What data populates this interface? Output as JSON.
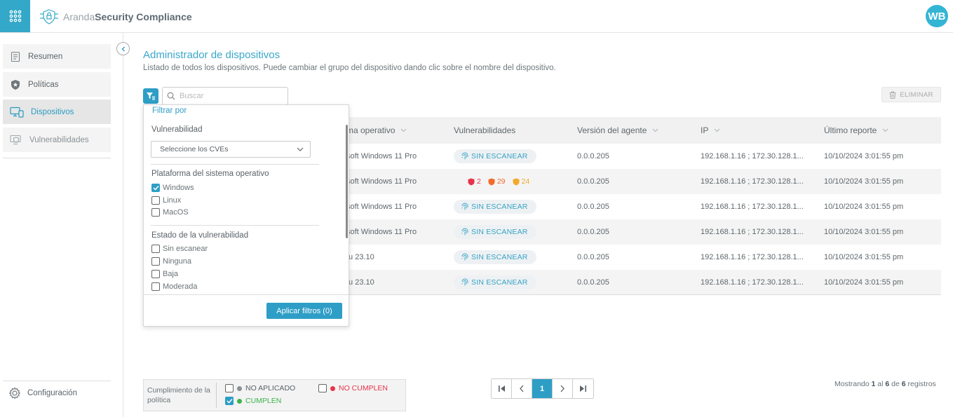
{
  "header": {
    "brand_light": "Aranda",
    "brand_bold": "Security Compliance",
    "avatar_initials": "WB"
  },
  "sidebar": {
    "items": [
      {
        "label": "Resumen",
        "icon": "report-icon"
      },
      {
        "label": "Políticas",
        "icon": "shield-star-icon"
      },
      {
        "label": "Dispositivos",
        "icon": "devices-icon"
      },
      {
        "label": "Vulnerabilidades",
        "icon": "vulnerability-icon"
      }
    ],
    "config_label": "Configuración"
  },
  "main": {
    "title": "Administrador de dispositivos",
    "subtitle": "Listado de todos los dispositivos. Puede cambiar el grupo del dispositivo dando clic sobre el nombre del dispositivo.",
    "search_placeholder": "Buscar",
    "delete_label": "ELIMINAR"
  },
  "table": {
    "columns": [
      "ma operativo",
      "Vulnerabilidades",
      "Versión del agente",
      "IP",
      "Último reporte"
    ],
    "rows": [
      {
        "os": "soft Windows 11 Pro",
        "vuln": "SIN ESCANEAR",
        "agent": "0.0.0.205",
        "ip": "192.168.1.16 ; 172.30.128.1...",
        "report": "10/10/2024 3:01:55 pm"
      },
      {
        "os": "soft Windows 11 Pro",
        "vuln_counts": {
          "critical": "2",
          "high": "29",
          "medium": "24"
        },
        "agent": "0.0.0.205",
        "ip": "192.168.1.16 ; 172.30.128.1...",
        "report": "10/10/2024 3:01:55 pm"
      },
      {
        "os": "soft Windows 11 Pro",
        "vuln": "SIN ESCANEAR",
        "agent": "0.0.0.205",
        "ip": "192.168.1.16 ; 172.30.128.1...",
        "report": "10/10/2024 3:01:55 pm"
      },
      {
        "os": "soft Windows 11 Pro",
        "vuln": "SIN ESCANEAR",
        "agent": "0.0.0.205",
        "ip": "192.168.1.16 ; 172.30.128.1...",
        "report": "10/10/2024 3:01:55 pm"
      },
      {
        "os": "tu 23.10",
        "vuln": "SIN ESCANEAR",
        "agent": "0.0.0.205",
        "ip": "192.168.1.16 ; 172.30.128.1...",
        "report": "10/10/2024 3:01:55 pm"
      },
      {
        "os": "tu 23.10",
        "vuln": "SIN ESCANEAR",
        "agent": "0.0.0.205",
        "ip": "192.168.1.16 ; 172.30.128.1...",
        "report": "10/10/2024 3:01:55 pm"
      }
    ]
  },
  "filter": {
    "title": "Filtrar por",
    "vuln_section": "Vulnerabilidad",
    "cve_select": "Seleccione los CVEs",
    "platform_section": "Plataforma del sistema operativo",
    "platforms": [
      {
        "label": "Windows",
        "checked": true
      },
      {
        "label": "Linux",
        "checked": false
      },
      {
        "label": "MacOS",
        "checked": false
      }
    ],
    "state_section": "Estado de la vulnerabilidad",
    "states": [
      {
        "label": "Sin escanear",
        "checked": false
      },
      {
        "label": "Ninguna",
        "checked": false
      },
      {
        "label": "Baja",
        "checked": false
      },
      {
        "label": "Moderada",
        "checked": false
      }
    ],
    "apply_label": "Aplicar filtros (0)"
  },
  "legend": {
    "label": "Cumplimiento de la política",
    "items": [
      {
        "label": "NO APLICADO",
        "checked": false,
        "color": "#8a9196"
      },
      {
        "label": "NO CUMPLEN",
        "checked": false,
        "color": "#e8334a"
      },
      {
        "label": "CUMPLEN",
        "checked": true,
        "color": "#3cb44a"
      }
    ]
  },
  "pagination": {
    "current_page": "1",
    "records_prefix": "Mostrando",
    "records_from": "1",
    "records_mid": "al",
    "records_to": "6",
    "records_of": "de",
    "records_total": "6",
    "records_suffix": "registros"
  },
  "colors": {
    "accent": "#2e9ec6",
    "critical": "#e8334a",
    "high": "#f26b2a",
    "medium": "#f2a92a"
  }
}
